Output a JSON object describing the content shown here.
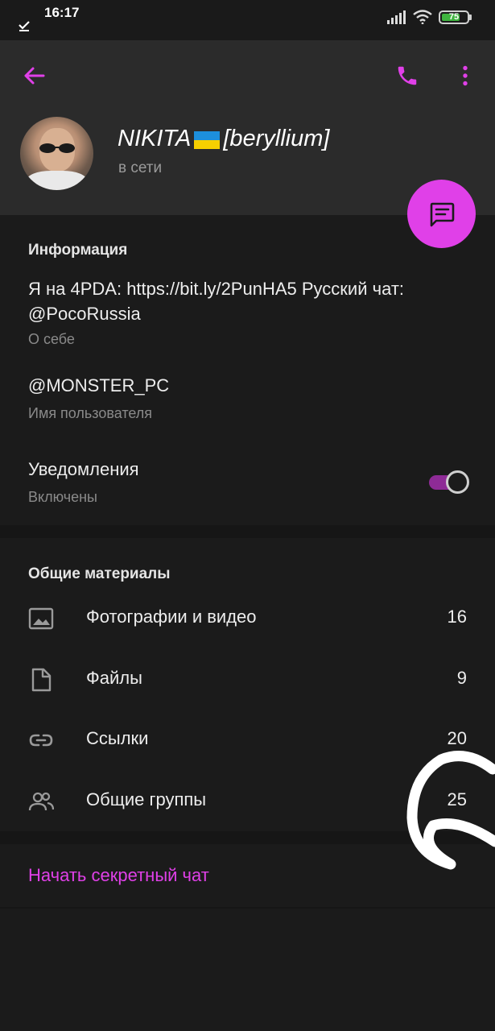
{
  "status_bar": {
    "time": "16:17",
    "battery_level": "75",
    "battery_percent": 75,
    "icons": [
      "check-icon",
      "signal-icon",
      "wifi-icon",
      "battery-icon"
    ]
  },
  "toolbar": {
    "icons": [
      "back-arrow-icon",
      "phone-icon",
      "more-vertical-icon"
    ],
    "accent_color": "#e040e8"
  },
  "profile": {
    "name_before_flag": "NIKITA",
    "name_after_flag": "[beryllium]",
    "flag": "ukraine-flag",
    "status": "в сети"
  },
  "info": {
    "title": "Информация",
    "bio": "Я на 4PDA: https://bit.ly/2PunHA5 Русский чат: @PocoRussia",
    "bio_label": "О себе",
    "username": "@MONSTER_PC",
    "username_label": "Имя пользователя",
    "notifications": "Уведомления",
    "notifications_state": "Включены",
    "notifications_on": true
  },
  "shared_media": {
    "title": "Общие материалы",
    "items": [
      {
        "label": "Фотографии и видео",
        "count": "16",
        "icon": "image-icon"
      },
      {
        "label": "Файлы",
        "count": "9",
        "icon": "file-icon"
      },
      {
        "label": "Ссылки",
        "count": "20",
        "icon": "link-icon"
      },
      {
        "label": "Общие группы",
        "count": "25",
        "icon": "group-icon"
      }
    ]
  },
  "actions": {
    "secret_chat": "Начать секретный чат"
  },
  "colors": {
    "accent": "#e040e8",
    "background": "#1b1b1b",
    "header": "#2b2b2b",
    "toggle_track": "#8e2b96"
  }
}
